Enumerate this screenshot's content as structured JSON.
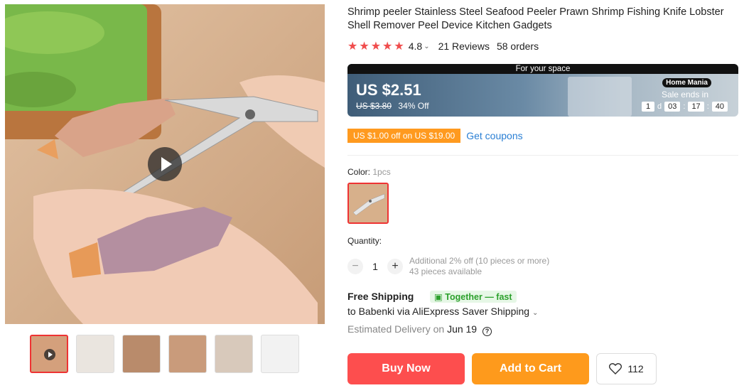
{
  "product": {
    "title": "Shrimp peeler Stainless Steel Seafood Peeler Prawn Shrimp Fishing Knife Lobster Shell Remover Peel Device Kitchen Gadgets",
    "rating": "4.8",
    "reviews": "21 Reviews",
    "orders": "58 orders",
    "star_color": "#f04d4d"
  },
  "banner": {
    "top_text": "For your space",
    "price": "US $2.51",
    "original_price": "US $3.80",
    "discount": "34% Off",
    "store_badge": "Home Mania",
    "sale_ends": "Sale ends in",
    "countdown": {
      "days": "1",
      "d_label": "d",
      "hours": "03",
      "minutes": "17",
      "seconds": "40"
    }
  },
  "coupon": {
    "tag": "US $1.00 off on US $19.00",
    "link": "Get coupons",
    "tag_color": "#ff9a1f",
    "link_color": "#2a7fd4"
  },
  "color": {
    "label": "Color:",
    "selected": "1pcs"
  },
  "quantity": {
    "label": "Quantity:",
    "minus": "−",
    "value": "1",
    "plus": "+",
    "note_line1": "Additional 2% off (10 pieces or more)",
    "note_line2": "43 pieces available"
  },
  "shipping": {
    "title": "Free Shipping",
    "badge": "Together — fast",
    "line": "to Babenki via AliExpress Saver Shipping",
    "delivery_label": "Estimated Delivery on",
    "delivery_date": "Jun 19",
    "help": "?"
  },
  "actions": {
    "buy": "Buy Now",
    "cart": "Add to Cart",
    "wish_count": "112",
    "buy_color": "#fd4e4e",
    "cart_color": "#fe9a1c"
  }
}
